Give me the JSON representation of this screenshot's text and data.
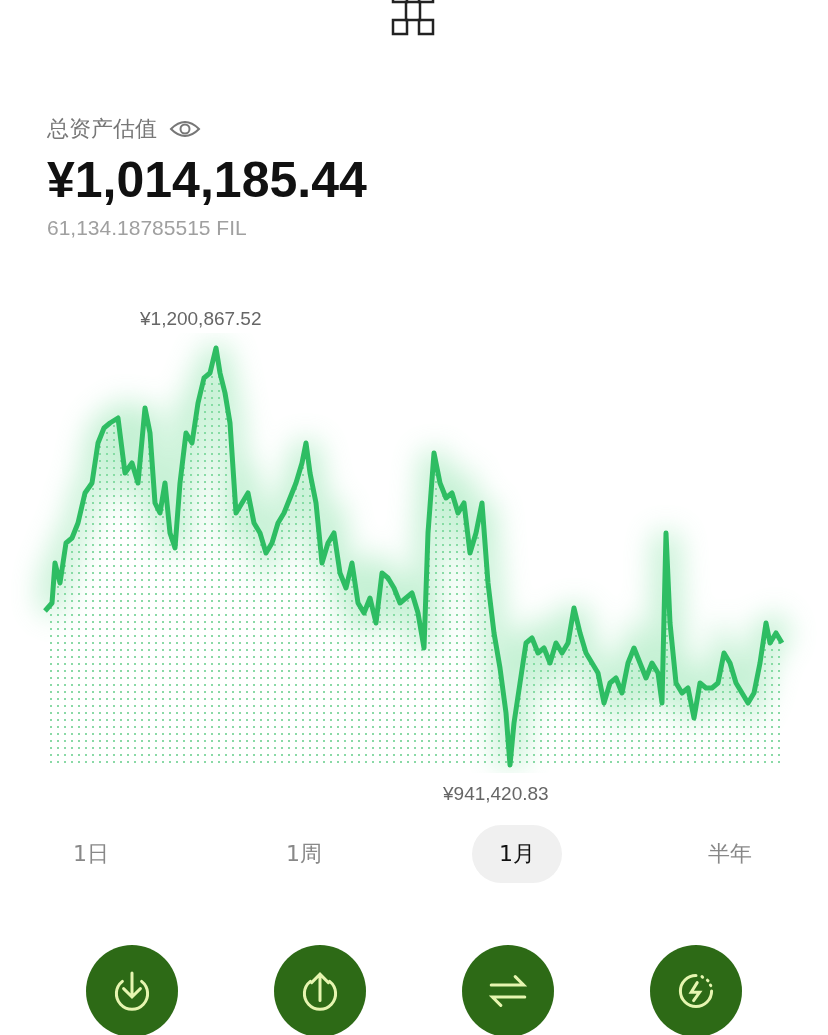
{
  "header": {
    "label": "总资产估值",
    "amount": "¥1,014,185.44",
    "crypto_amount": "61,134.18785515 FIL"
  },
  "chart": {
    "high_label": "¥1,200,867.52",
    "low_label": "¥941,420.83"
  },
  "periods": [
    {
      "label": "1日",
      "selected": false
    },
    {
      "label": "1周",
      "selected": false
    },
    {
      "label": "1月",
      "selected": true
    },
    {
      "label": "半年",
      "selected": false
    }
  ],
  "actions": [
    {
      "kind": "deposit"
    },
    {
      "kind": "withdraw"
    },
    {
      "kind": "swap"
    },
    {
      "kind": "boost"
    }
  ]
}
